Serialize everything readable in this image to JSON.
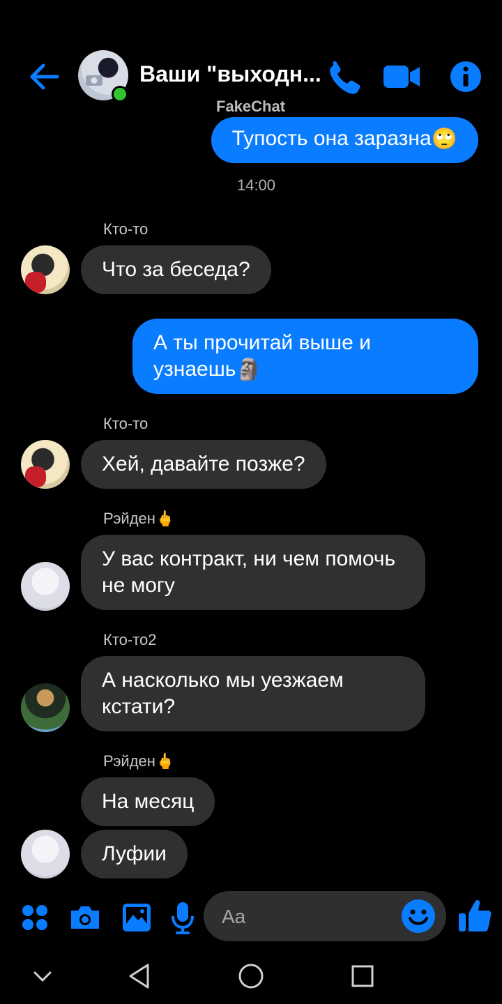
{
  "header": {
    "title": "Ваши \"выходн...",
    "watermark": "FakeChat",
    "back_icon": "arrow-left-icon",
    "call_icon": "phone-icon",
    "video_icon": "video-camera-icon",
    "info_icon": "info-icon",
    "accent_color": "#0a7cff"
  },
  "messages": [
    {
      "type": "outgoing",
      "text": "Тупость она заразна",
      "emoji": "🙄"
    },
    {
      "type": "timestamp",
      "text": "14:00"
    },
    {
      "type": "incoming",
      "sender": "Кто-то",
      "text": "Что за беседа?"
    },
    {
      "type": "outgoing",
      "text": "А ты прочитай выше и узнаешь",
      "emoji": "🗿"
    },
    {
      "type": "incoming",
      "sender": "Кто-то",
      "text": "Хей, давайте позже?"
    },
    {
      "type": "incoming",
      "sender": "Рэйден",
      "sender_emoji": "🖕",
      "text": "У вас контракт, ни чем помочь не могу"
    },
    {
      "type": "incoming",
      "sender": "Кто-то2",
      "text": "А насколько мы уезжаем кстати?"
    },
    {
      "type": "incoming",
      "sender": "Рэйден",
      "sender_emoji": "🖕",
      "text": "На месяц"
    },
    {
      "type": "incoming",
      "text": "Луфии"
    }
  ],
  "composer": {
    "placeholder": "Aa",
    "icons": [
      "apps-icon",
      "camera-icon",
      "gallery-icon",
      "microphone-icon",
      "emoji-icon",
      "like-icon"
    ]
  },
  "navbar": {
    "icons": [
      "chevron-down-icon",
      "back-triangle-icon",
      "home-circle-icon",
      "recents-square-icon"
    ]
  }
}
